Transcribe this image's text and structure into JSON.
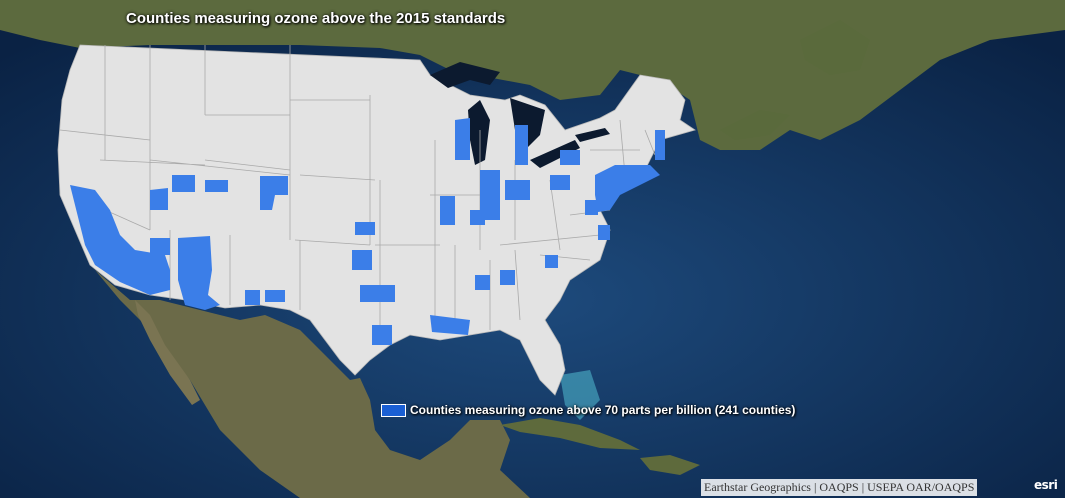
{
  "map": {
    "title": "Counties measuring ozone above the 2015 standards",
    "colors": {
      "ocean": "#0d2a4e",
      "land": "#5f6b3e",
      "us_land": "#e3e3e3",
      "county_highlight": "#3b7ee8",
      "lakes": "#0a1830"
    }
  },
  "legend": {
    "label": "Counties measuring ozone above 70 parts per billion (241 counties)",
    "swatch_color": "#1a5fd4"
  },
  "attribution": {
    "text": "Earthstar Geographics | OAQPS | USEPA OAR/OAQPS"
  },
  "logo": {
    "text": "esri",
    "icon": "esri-logo"
  }
}
